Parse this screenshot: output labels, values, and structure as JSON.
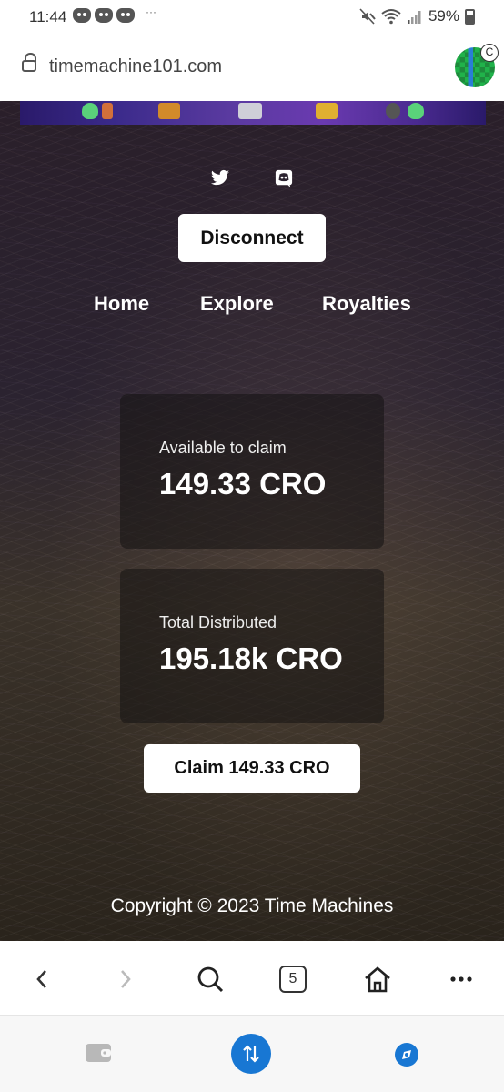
{
  "status_bar": {
    "time": "11:44",
    "more": "···",
    "battery": "59%",
    "notification_icons": [
      "discord-icon",
      "discord-icon",
      "discord-icon"
    ],
    "system_icons": [
      "mute-icon",
      "wifi-icon",
      "signal-icon",
      "battery-icon"
    ]
  },
  "browser": {
    "url": "timemachine101.com",
    "profile_badge": "C",
    "open_tabs": "5"
  },
  "page": {
    "disconnect_label": "Disconnect",
    "nav": {
      "home": "Home",
      "explore": "Explore",
      "royalties": "Royalties"
    },
    "available": {
      "label": "Available to claim",
      "value": "149.33 CRO"
    },
    "distributed": {
      "label": "Total Distributed",
      "value": "195.18k CRO"
    },
    "claim_label": "Claim 149.33 CRO",
    "copyright": "Copyright © 2023 Time Machines",
    "social_icons": [
      "twitter-icon",
      "discord-icon"
    ]
  },
  "colors": {
    "button_bg": "#ffffff",
    "card_bg": "#141212",
    "bottom_accent": "#1877d3"
  }
}
